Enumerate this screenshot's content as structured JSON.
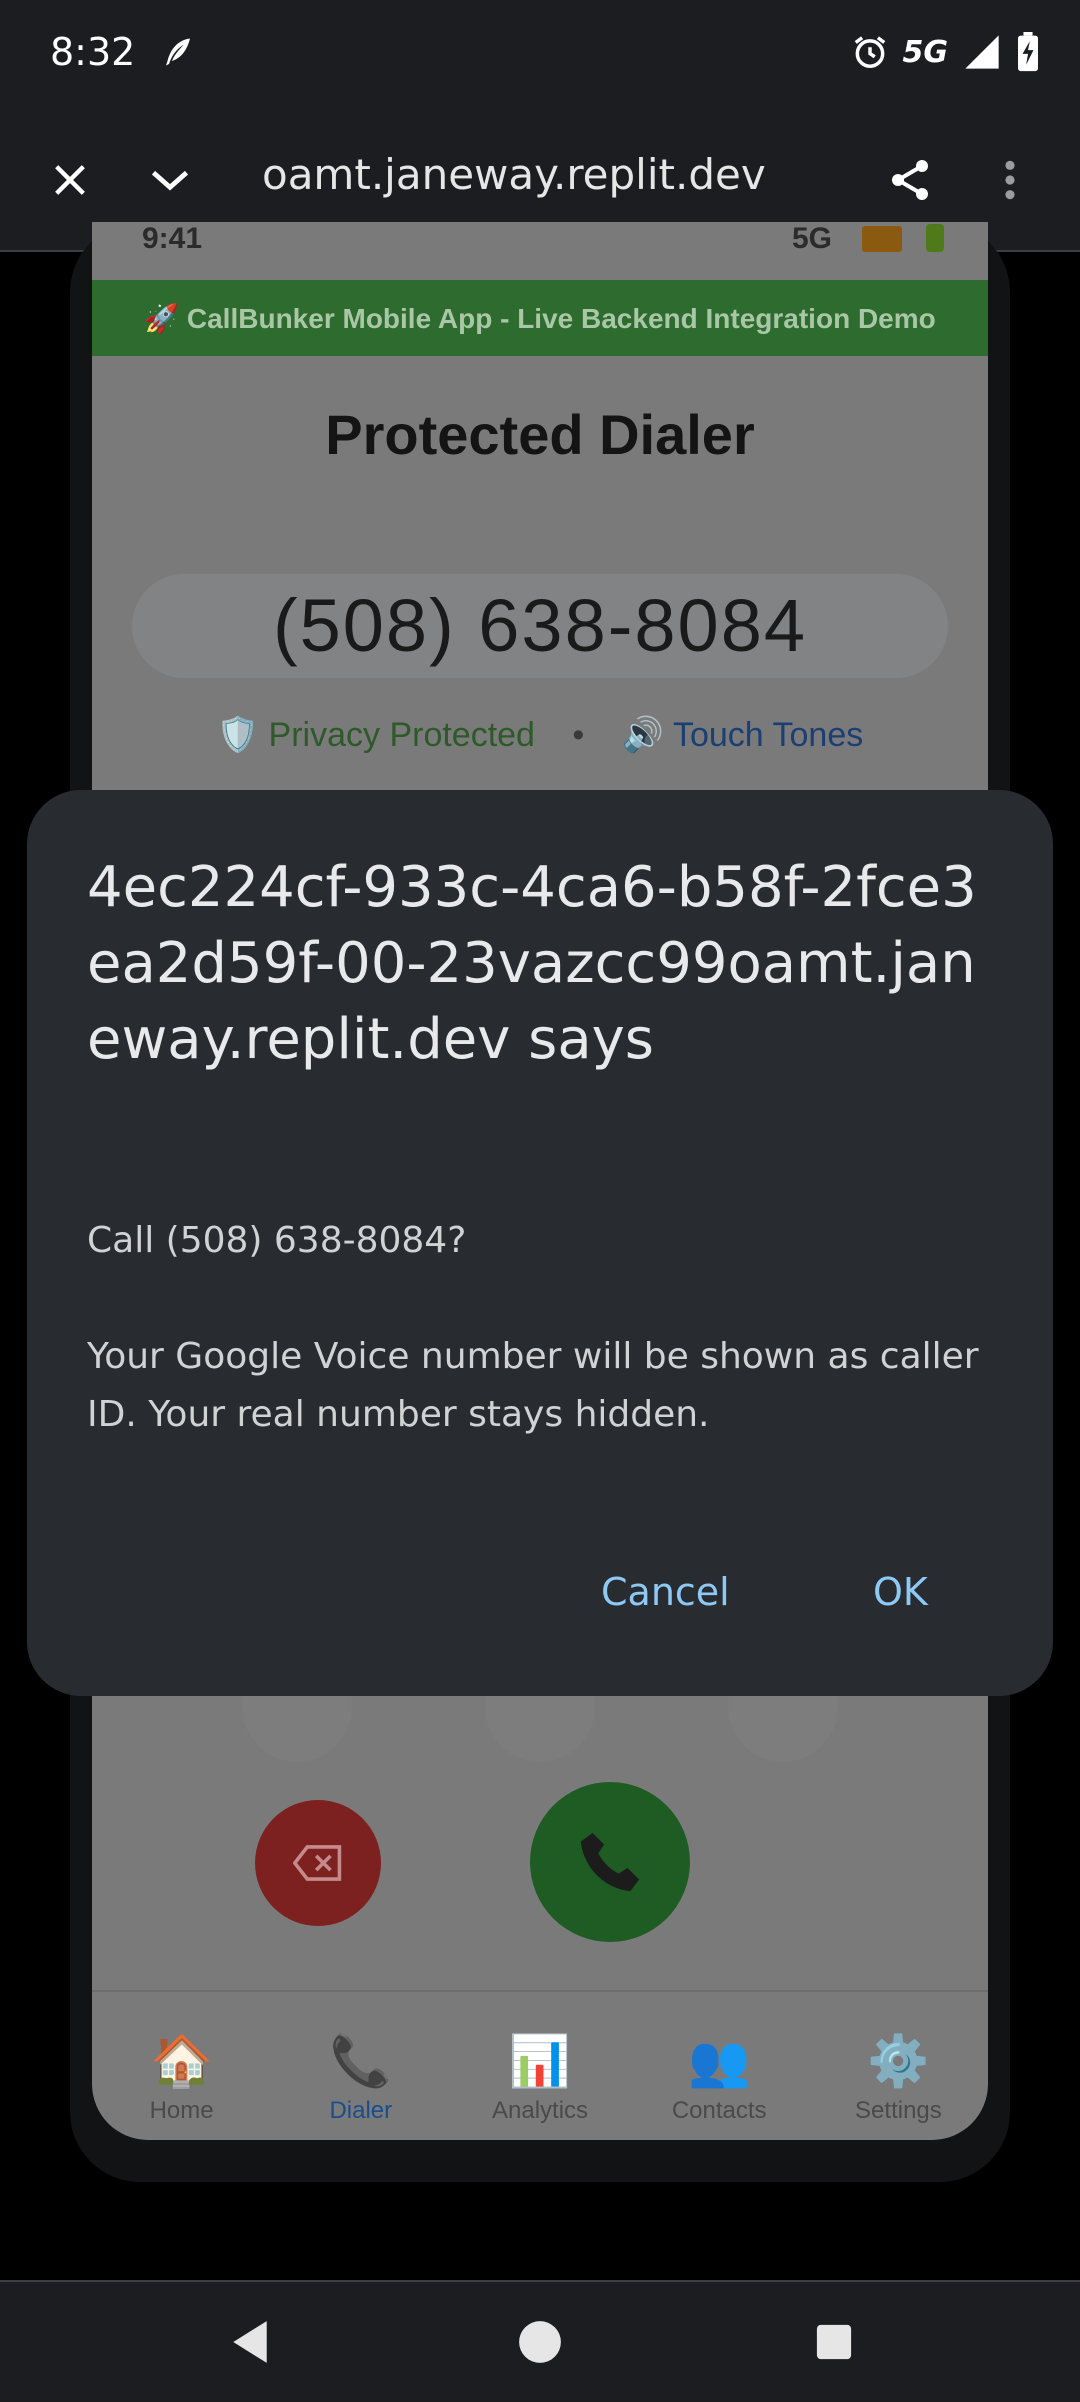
{
  "status_bar": {
    "time": "8:32",
    "network": "5G"
  },
  "browser_bar": {
    "url": "oamt.janeway.replit.dev"
  },
  "page": {
    "mock_status": {
      "time": "9:41",
      "network": "5G"
    },
    "banner": "🚀 CallBunker Mobile App - Live Backend Integration Demo",
    "title": "Protected Dialer",
    "number": "(508) 638-8084",
    "privacy": "🛡️ Privacy Protected",
    "separator": "•",
    "touch_tones": "🔊 Touch Tones",
    "tabs": [
      {
        "icon": "🏠",
        "label": "Home"
      },
      {
        "icon": "📞",
        "label": "Dialer"
      },
      {
        "icon": "📊",
        "label": "Analytics"
      },
      {
        "icon": "👥",
        "label": "Contacts"
      },
      {
        "icon": "⚙️",
        "label": "Settings"
      }
    ]
  },
  "dialog": {
    "title": "4ec224cf-933c-4ca6-b58f-2fce3ea2d59f-00-23vazcc99oamt.janeway.replit.dev says",
    "question": "Call (508) 638-8084?",
    "message": "Your Google Voice number will be shown as caller ID. Your real number stays hidden.",
    "cancel": "Cancel",
    "ok": "OK"
  },
  "colors": {
    "dialog_button": "#8ec9f5",
    "dialog_bg": "#282c31",
    "active_tab": "#1a4d8c"
  }
}
